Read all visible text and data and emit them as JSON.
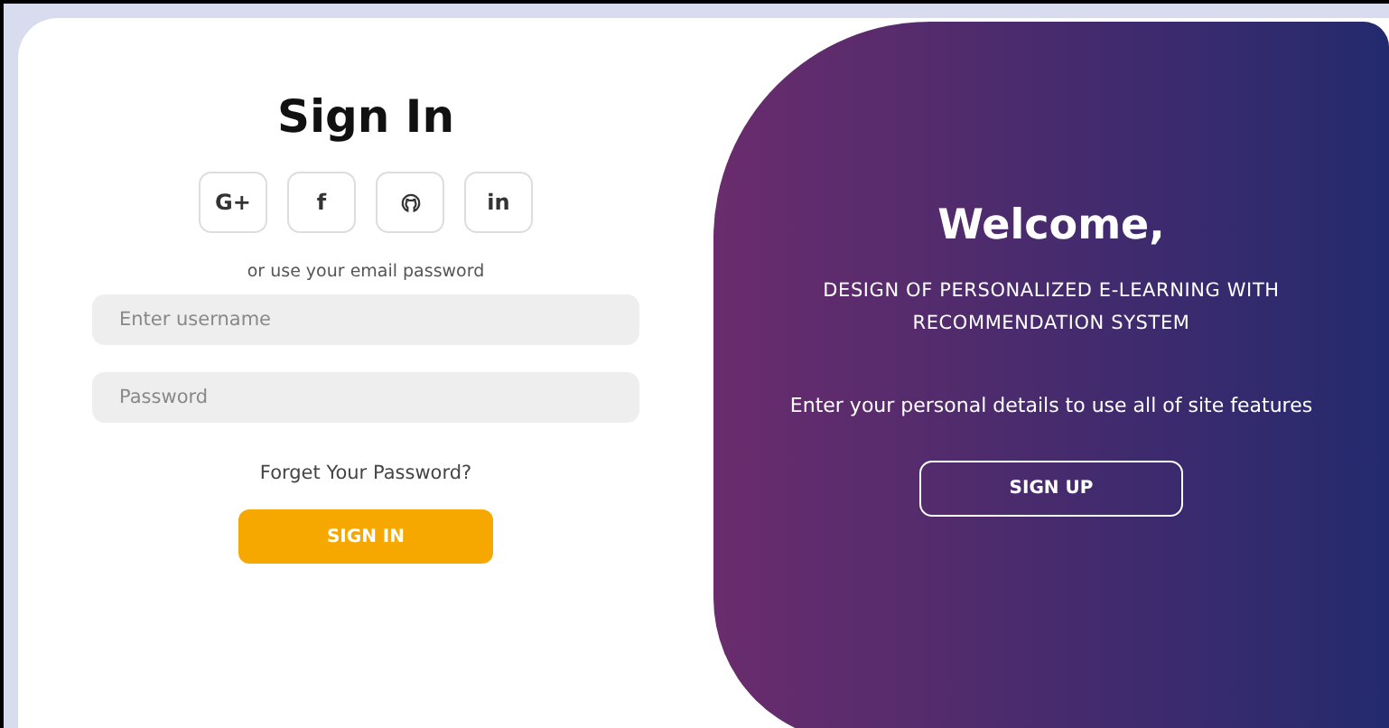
{
  "sign_in": {
    "title": "Sign In",
    "social_buttons": [
      {
        "kind": "text",
        "label": "G+"
      },
      {
        "kind": "text",
        "label": "f"
      },
      {
        "kind": "github"
      },
      {
        "kind": "text",
        "label": "in"
      }
    ],
    "hint": "or use your email password",
    "fields": [
      {
        "placeholder": "Enter username"
      },
      {
        "placeholder": "Password"
      }
    ],
    "forgot_link": "Forget Your Password?",
    "button": "SIGN IN"
  },
  "welcome": {
    "title": "Welcome,",
    "subtitle": "DESIGN OF PERSONALIZED E-LEARNING WITH RECOMMENDATION SYSTEM",
    "text": "Enter your personal details to use all of site features",
    "button": "SIGN UP"
  }
}
